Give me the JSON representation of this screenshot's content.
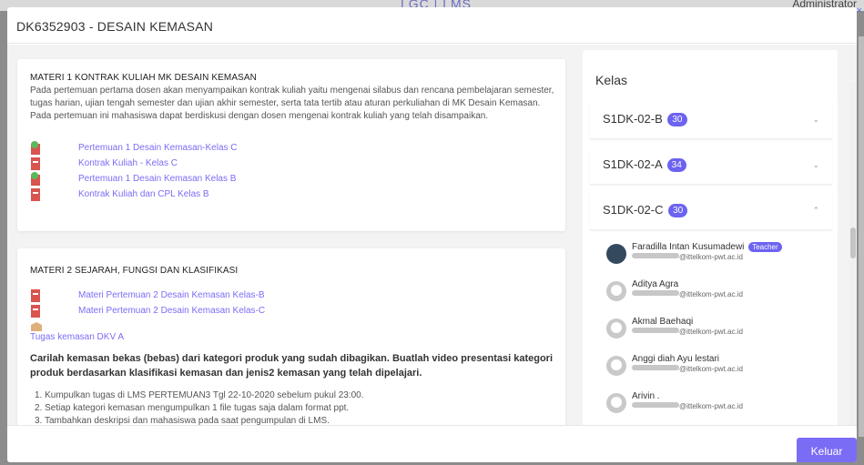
{
  "background": {
    "logo": "LGC | LMS",
    "user": "Administrator",
    "close_glyph": "×"
  },
  "modal": {
    "title": "DK6352903 - DESAIN KEMASAN",
    "footer_button": "Keluar"
  },
  "materi": [
    {
      "title": "MATERI 1 KONTRAK KULIAH MK DESAIN KEMASAN",
      "description": "Pada pertemuan pertama dosen akan menyampaikan kontrak kuliah yaitu mengenai silabus dan rencana pembelajaran semester, tugas harian, ujian tengah semester dan ujian akhir semester, serta tata tertib atau aturan perkuliahan di MK Desain Kemasan. Pada pertemuan ini mahasiswa dapat berdiskusi dengan dosen mengenai kontrak kuliah yang telah disampaikan.",
      "files": [
        {
          "label": "Pertemuan 1 Desain Kemasan-Kelas C",
          "icon": "green-red-file-icon"
        },
        {
          "label": "Kontrak Kuliah - Kelas C",
          "icon": "pdf-file-icon"
        },
        {
          "label": "Pertemuan 1 Desain Kemasan Kelas B",
          "icon": "green-red-file-icon"
        },
        {
          "label": "Kontrak Kuliah dan CPL Kelas B",
          "icon": "pdf-file-icon"
        }
      ]
    },
    {
      "title": "MATERI 2 SEJARAH, FUNGSI DAN KLASIFIKASI",
      "files": [
        {
          "label": "Materi Pertemuan 2 Desain Kemasan Kelas-B",
          "icon": "pdf-file-icon"
        },
        {
          "label": "Materi Pertemuan 2 Desain Kemasan Kelas-C",
          "icon": "pdf-file-icon"
        }
      ],
      "tugas_label": "Tugas kemasan DKV A",
      "tugas_description": "Carilah kemasan bekas (bebas) dari kategori produk yang sudah dibagikan. Buatlah video presentasi kategori produk berdasarkan klasifikasi kemasan dan jenis2 kemasan yang telah dipelajari.",
      "steps": [
        "1. Kumpulkan tugas di LMS PERTEMUAN3 Tgl 22-10-2020 sebelum pukul 23:00.",
        "2. Setiap kategori kemasan mengumpulkan 1 file tugas saja dalam format ppt.",
        "3. Tambahkan deskripsi dan mahasiswa pada saat pengumpulan di LMS."
      ]
    }
  ],
  "kelas": {
    "heading": "Kelas",
    "items": [
      {
        "name": "S1DK-02-B",
        "count": "30",
        "chevron": "⌄"
      },
      {
        "name": "S1DK-02-A",
        "count": "34",
        "chevron": "⌄"
      },
      {
        "name": "S1DK-02-C",
        "count": "30",
        "chevron": "⌃"
      }
    ],
    "members": [
      {
        "name": "Faradilla Intan Kusumadewi",
        "role": "Teacher",
        "email_suffix": "@ittelkom-pwt.ac.id"
      },
      {
        "name": "Aditya Agra",
        "email_suffix": "@ittelkom-pwt.ac.id"
      },
      {
        "name": "Akmal Baehaqi",
        "email_suffix": "@ittelkom-pwt.ac.id"
      },
      {
        "name": "Anggi diah Ayu lestari",
        "email_suffix": "@ittelkom-pwt.ac.id"
      },
      {
        "name": "Arivin .",
        "email_suffix": "@ittelkom-pwt.ac.id"
      }
    ]
  },
  "colors": {
    "accent": "#7b6cf6",
    "badge": "#6c63f0"
  }
}
